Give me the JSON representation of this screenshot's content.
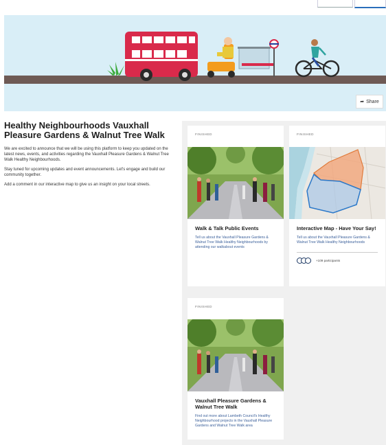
{
  "top_nav": {
    "buttons": [
      "",
      ""
    ]
  },
  "hero": {
    "share_label": "Share"
  },
  "intro": {
    "title": "Healthy Neighbourhoods Vauxhall Pleasure Gardens & Walnut Tree Walk",
    "paragraphs": [
      "We are excited to announce that we will be using this platform to keep you updated on the latest news, events, and activities regarding the Vauxhall Pleasure Gardens & Walnut Tree Walk Healthy Neighbourhoods.",
      "Stay tuned for upcoming updates and event announcements. Let's engage and build our community together.",
      "Add a comment in our interactive map to give us an insight on your local streets."
    ]
  },
  "cards": [
    {
      "status": "FINISHED",
      "title": "Walk & Talk Public Events",
      "description": "Tell us about the Vauxhall Pleasure Gardens & Walnut Tree Walk Healthy Neighbourhoods by attending our walkabout events"
    },
    {
      "status": "FINISHED",
      "title": "Interactive Map - Have Your Say!",
      "description": "Tell us about the Vauxhall Pleasure Gardens & Walnut Tree Walk Healthy Neighbourhoods",
      "participants": "+109 participants"
    },
    {
      "status": "FINISHED",
      "title": "Vauxhall Pleasure Gardens & Walnut Tree Walk",
      "description": "Find out more about Lambeth Council's Healthy Neighbourhood projects in the Vauxhall Pleasure Gardens and Walnut Tree Walk area"
    }
  ],
  "colors": {
    "hero_bg": "#d9eef7",
    "bus_red": "#d92a4b",
    "road": "#6e5a55",
    "map_orange": "#f2a57a",
    "map_blue": "#2a78c9",
    "desc_blue": "#3a5f9a"
  }
}
